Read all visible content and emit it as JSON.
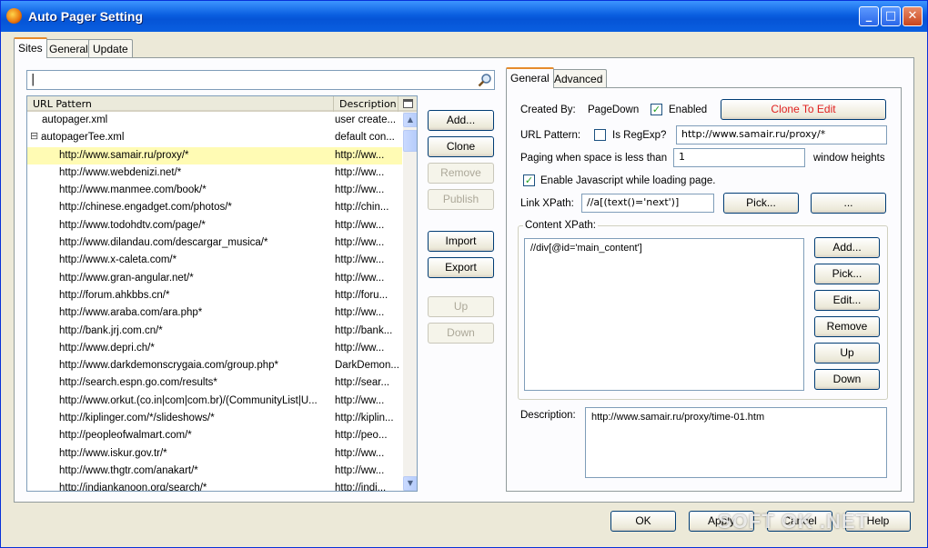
{
  "window": {
    "title": "Auto Pager Setting"
  },
  "tabs": [
    "Sites",
    "General",
    "Update"
  ],
  "sites": {
    "search": {
      "value": "|"
    },
    "columns": {
      "url": "URL Pattern",
      "desc": "Description"
    },
    "rows": [
      {
        "url": "autopager.xml",
        "desc": "user create...",
        "level": 0
      },
      {
        "url": "autopagerTee.xml",
        "desc": "default con...",
        "level": 0,
        "expander": "⊟"
      },
      {
        "url": "http://www.samair.ru/proxy/*",
        "desc": "http://ww...",
        "level": 1,
        "selected": true
      },
      {
        "url": "http://www.webdenizi.net/*",
        "desc": "http://ww...",
        "level": 1
      },
      {
        "url": "http://www.manmee.com/book/*",
        "desc": "http://ww...",
        "level": 1
      },
      {
        "url": "http://chinese.engadget.com/photos/*",
        "desc": "http://chin...",
        "level": 1
      },
      {
        "url": "http://www.todohdtv.com/page/*",
        "desc": "http://ww...",
        "level": 1
      },
      {
        "url": "http://www.dilandau.com/descargar_musica/*",
        "desc": "http://ww...",
        "level": 1
      },
      {
        "url": "http://www.x-caleta.com/*",
        "desc": "http://ww...",
        "level": 1
      },
      {
        "url": "http://www.gran-angular.net/*",
        "desc": "http://ww...",
        "level": 1
      },
      {
        "url": "http://forum.ahkbbs.cn/*",
        "desc": "http://foru...",
        "level": 1
      },
      {
        "url": "http://www.araba.com/ara.php*",
        "desc": "http://ww...",
        "level": 1
      },
      {
        "url": "http://bank.jrj.com.cn/*",
        "desc": "http://bank...",
        "level": 1
      },
      {
        "url": "http://www.depri.ch/*",
        "desc": "http://ww...",
        "level": 1
      },
      {
        "url": "http://www.darkdemonscrygaia.com/group.php*",
        "desc": "DarkDemon...",
        "level": 1
      },
      {
        "url": "http://search.espn.go.com/results*",
        "desc": "http://sear...",
        "level": 1
      },
      {
        "url": "http://www.orkut.(co.in|com|com.br)/(CommunityList|U...",
        "desc": "http://ww...",
        "level": 1
      },
      {
        "url": "http://kiplinger.com/*/slideshows/*",
        "desc": "http://kiplin...",
        "level": 1
      },
      {
        "url": "http://peopleofwalmart.com/*",
        "desc": "http://peo...",
        "level": 1
      },
      {
        "url": "http://www.iskur.gov.tr/*",
        "desc": "http://ww...",
        "level": 1
      },
      {
        "url": "http://www.thgtr.com/anakart/*",
        "desc": "http://ww...",
        "level": 1
      },
      {
        "url": "http://indiankanoon.org/search/*",
        "desc": "http://indi...",
        "level": 1
      }
    ],
    "buttons": {
      "add": "Add...",
      "clone": "Clone",
      "remove": "Remove",
      "publish": "Publish",
      "import": "Import",
      "export": "Export",
      "up": "Up",
      "down": "Down"
    }
  },
  "detail": {
    "tabs": [
      "General",
      "Advanced"
    ],
    "created_by_label": "Created By:",
    "created_by_value": "PageDown",
    "enabled_label": "Enabled",
    "clone_to_edit": "Clone To Edit",
    "url_pattern_label": "URL Pattern:",
    "is_regexp_label": "Is RegExp?",
    "url_pattern_value": "http://www.samair.ru/proxy/*",
    "paging_label": "Paging when space is less than",
    "paging_value": "1",
    "window_heights_label": "window heights",
    "enable_js_label": "Enable Javascript while loading page.",
    "link_xpath_label": "Link XPath:",
    "link_xpath_value": "//a[(text()='next')]",
    "pick_label": "Pick...",
    "more_label": "...",
    "content_xpath_label": "Content XPath:",
    "content_xpath_value": "//div[@id='main_content']",
    "content_buttons": {
      "add": "Add...",
      "pick": "Pick...",
      "edit": "Edit...",
      "remove": "Remove",
      "up": "Up",
      "down": "Down"
    },
    "description_label": "Description:",
    "description_value": "http://www.samair.ru/proxy/time-01.htm"
  },
  "footer": {
    "ok": "OK",
    "apply": "Apply",
    "cancel": "Cancel",
    "help": "Help"
  },
  "watermark": "SOFT OK .NET"
}
